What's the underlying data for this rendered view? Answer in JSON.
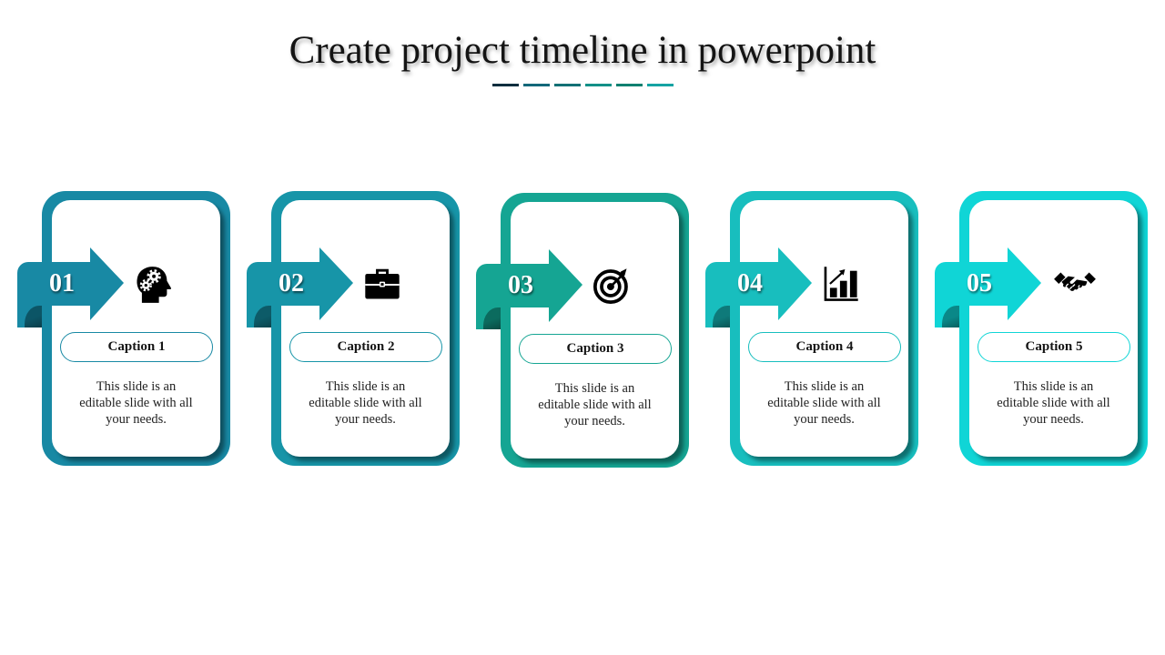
{
  "title": "Create project timeline in powerpoint",
  "divider_colors": [
    "#0b2e3e",
    "#13687a",
    "#137075",
    "#139088",
    "#108070",
    "#15a3a3"
  ],
  "steps": [
    {
      "number": "01",
      "icon": "head-gears-icon",
      "caption": "Caption 1",
      "text_lines": [
        "This slide is an",
        "editable slide with all",
        "your needs."
      ],
      "color": "#1889a4",
      "shade": "#0c5566"
    },
    {
      "number": "02",
      "icon": "briefcase-icon",
      "caption": "Caption 2",
      "text_lines": [
        "This slide is an",
        "editable slide with all",
        "your needs."
      ],
      "color": "#1795a8",
      "shade": "#0d5b68"
    },
    {
      "number": "03",
      "icon": "target-icon",
      "caption": "Caption 3",
      "text_lines": [
        "This slide is an",
        "editable slide with all",
        "your needs."
      ],
      "color": "#15a593",
      "shade": "#0b6b5e"
    },
    {
      "number": "04",
      "icon": "bar-chart-growth-icon",
      "caption": "Caption 4",
      "text_lines": [
        "This slide is an",
        "editable slide with all",
        "your needs."
      ],
      "color": "#18bebe",
      "shade": "#0e7a7a"
    },
    {
      "number": "05",
      "icon": "handshake-icon",
      "caption": "Caption 5",
      "text_lines": [
        "This slide is an",
        "editable slide with all",
        "your needs."
      ],
      "color": "#10d5d6",
      "shade": "#0a8888"
    }
  ]
}
